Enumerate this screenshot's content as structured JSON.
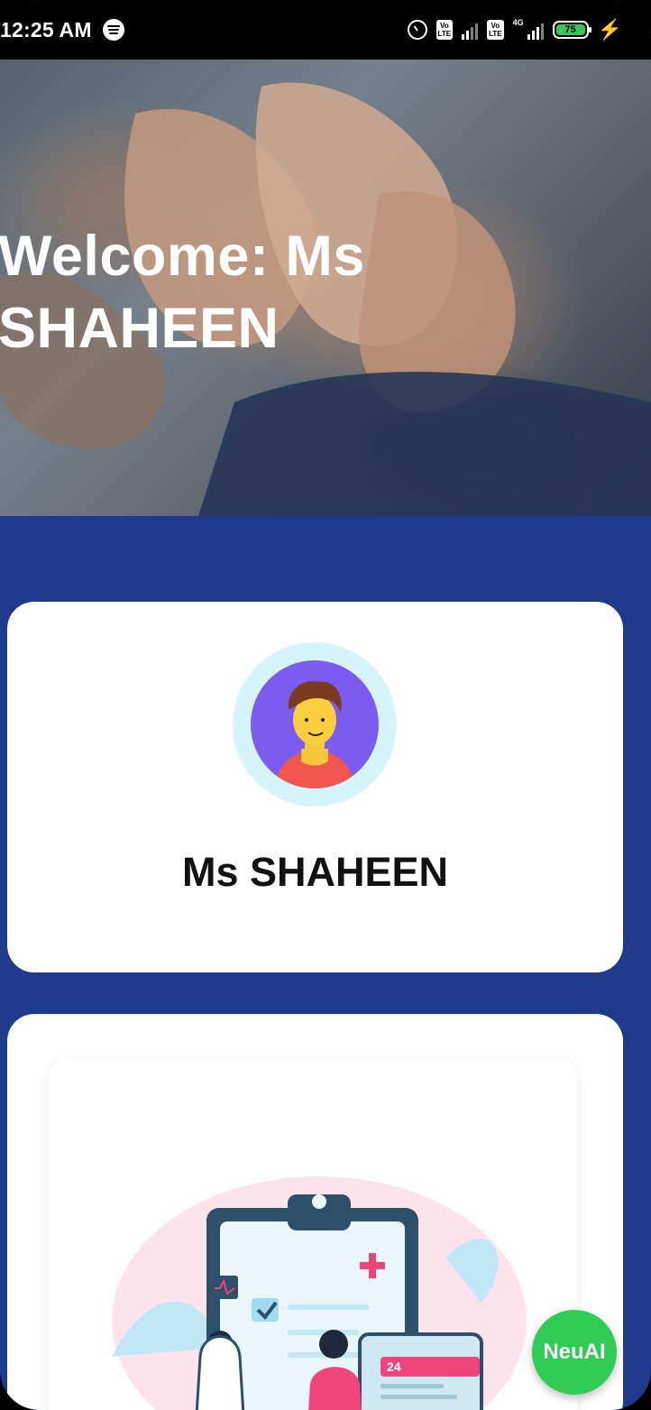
{
  "status_bar": {
    "time": "12:25 AM",
    "battery_level": "75",
    "icons": [
      "spotify-icon",
      "alarm-icon",
      "volte-icon",
      "signal-icon",
      "4g-icon",
      "battery-icon",
      "charging-icon"
    ]
  },
  "hero": {
    "title_line1": "Welcome: Ms",
    "title_line2": "SHAHEEN"
  },
  "profile": {
    "name": "Ms SHAHEEN",
    "avatar_icon": "user-avatar-icon"
  },
  "fab": {
    "label": "NeuAI"
  },
  "colors": {
    "page_background": "#1f3a8a",
    "card_background": "#ffffff",
    "avatar_ring": "#d5f5fb",
    "avatar_background": "#7a5cf0",
    "fab": "#2ecc55"
  }
}
